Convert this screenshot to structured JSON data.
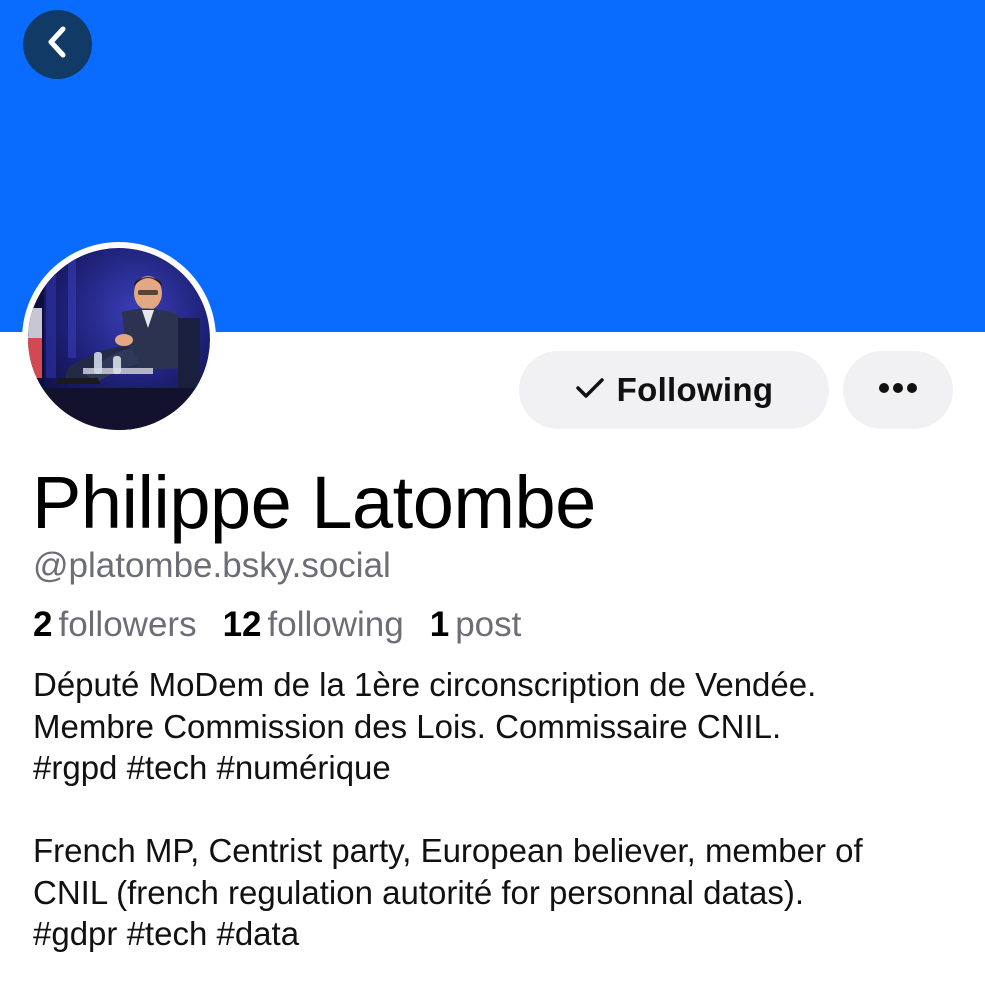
{
  "profile": {
    "banner_color": "#0a6cff",
    "display_name": "Philippe Latombe",
    "handle": "@platombe.bsky.social",
    "follow_button_label": "Following",
    "stats": [
      {
        "count": "2",
        "label": "followers"
      },
      {
        "count": "12",
        "label": "following"
      },
      {
        "count": "1",
        "label": "post"
      }
    ],
    "bio": {
      "paragraph_1": [
        "Député MoDem de la 1ère circonscription de Vendée.",
        "Membre Commission des Lois. Commissaire CNIL.",
        "#rgpd #tech #numérique"
      ],
      "paragraph_2": [
        "French MP, Centrist party, European believer, member of",
        "CNIL (french regulation autorité for personnal datas).",
        "#gdpr #tech #data"
      ]
    }
  },
  "icons": {
    "back": "chevron-left-icon",
    "following": "checkmark-icon",
    "more": "ellipsis-icon"
  }
}
